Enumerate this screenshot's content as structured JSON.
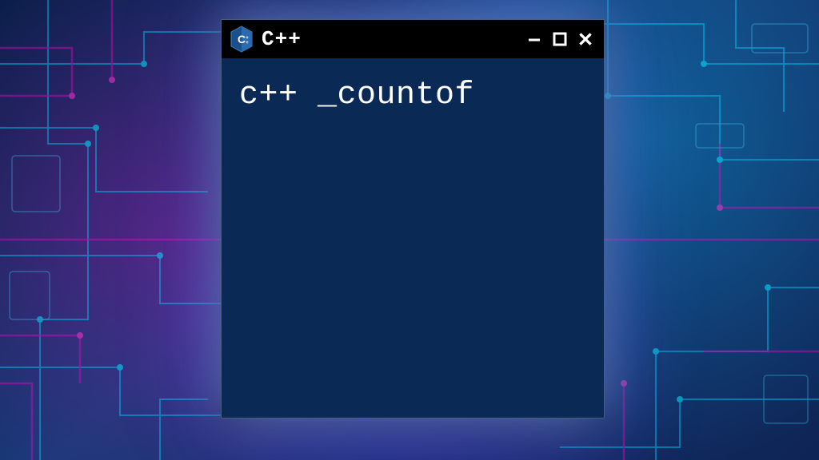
{
  "window": {
    "title": "C++",
    "content_line": "c++ _countof",
    "icon_label": "C++",
    "colors": {
      "titlebar_bg": "#000000",
      "content_bg": "#0a2a55",
      "text": "#ffffff",
      "glow": "#78b4ff"
    }
  }
}
